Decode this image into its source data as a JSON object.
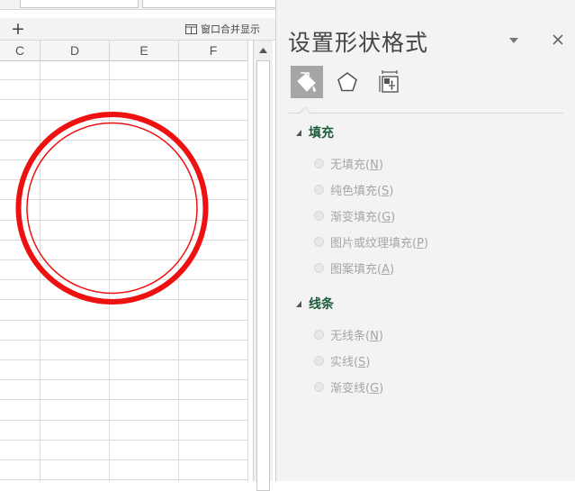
{
  "sheet": {
    "add_sheet_icon": "+",
    "merge_icon": "window-merge-icon",
    "merge_label": "窗口合并显示",
    "columns": [
      "C",
      "D",
      "E",
      "F"
    ]
  },
  "shape": {
    "type": "double-circle",
    "outline_color": "#ee1111"
  },
  "pane": {
    "title": "设置形状格式",
    "icon_tabs": [
      {
        "icon": "fill-bucket-icon",
        "active": true
      },
      {
        "icon": "pentagon-icon",
        "active": false
      },
      {
        "icon": "size-properties-icon",
        "active": false
      }
    ],
    "sections": [
      {
        "title": "填充",
        "options": [
          {
            "label": "无填充",
            "key": "N"
          },
          {
            "label": "纯色填充",
            "key": "S"
          },
          {
            "label": "渐变填充",
            "key": "G"
          },
          {
            "label": "图片或纹理填充",
            "key": "P"
          },
          {
            "label": "图案填充",
            "key": "A"
          }
        ]
      },
      {
        "title": "线条",
        "options": [
          {
            "label": "无线条",
            "key": "N"
          },
          {
            "label": "实线",
            "key": "S"
          },
          {
            "label": "渐变线",
            "key": "G"
          }
        ]
      }
    ]
  }
}
